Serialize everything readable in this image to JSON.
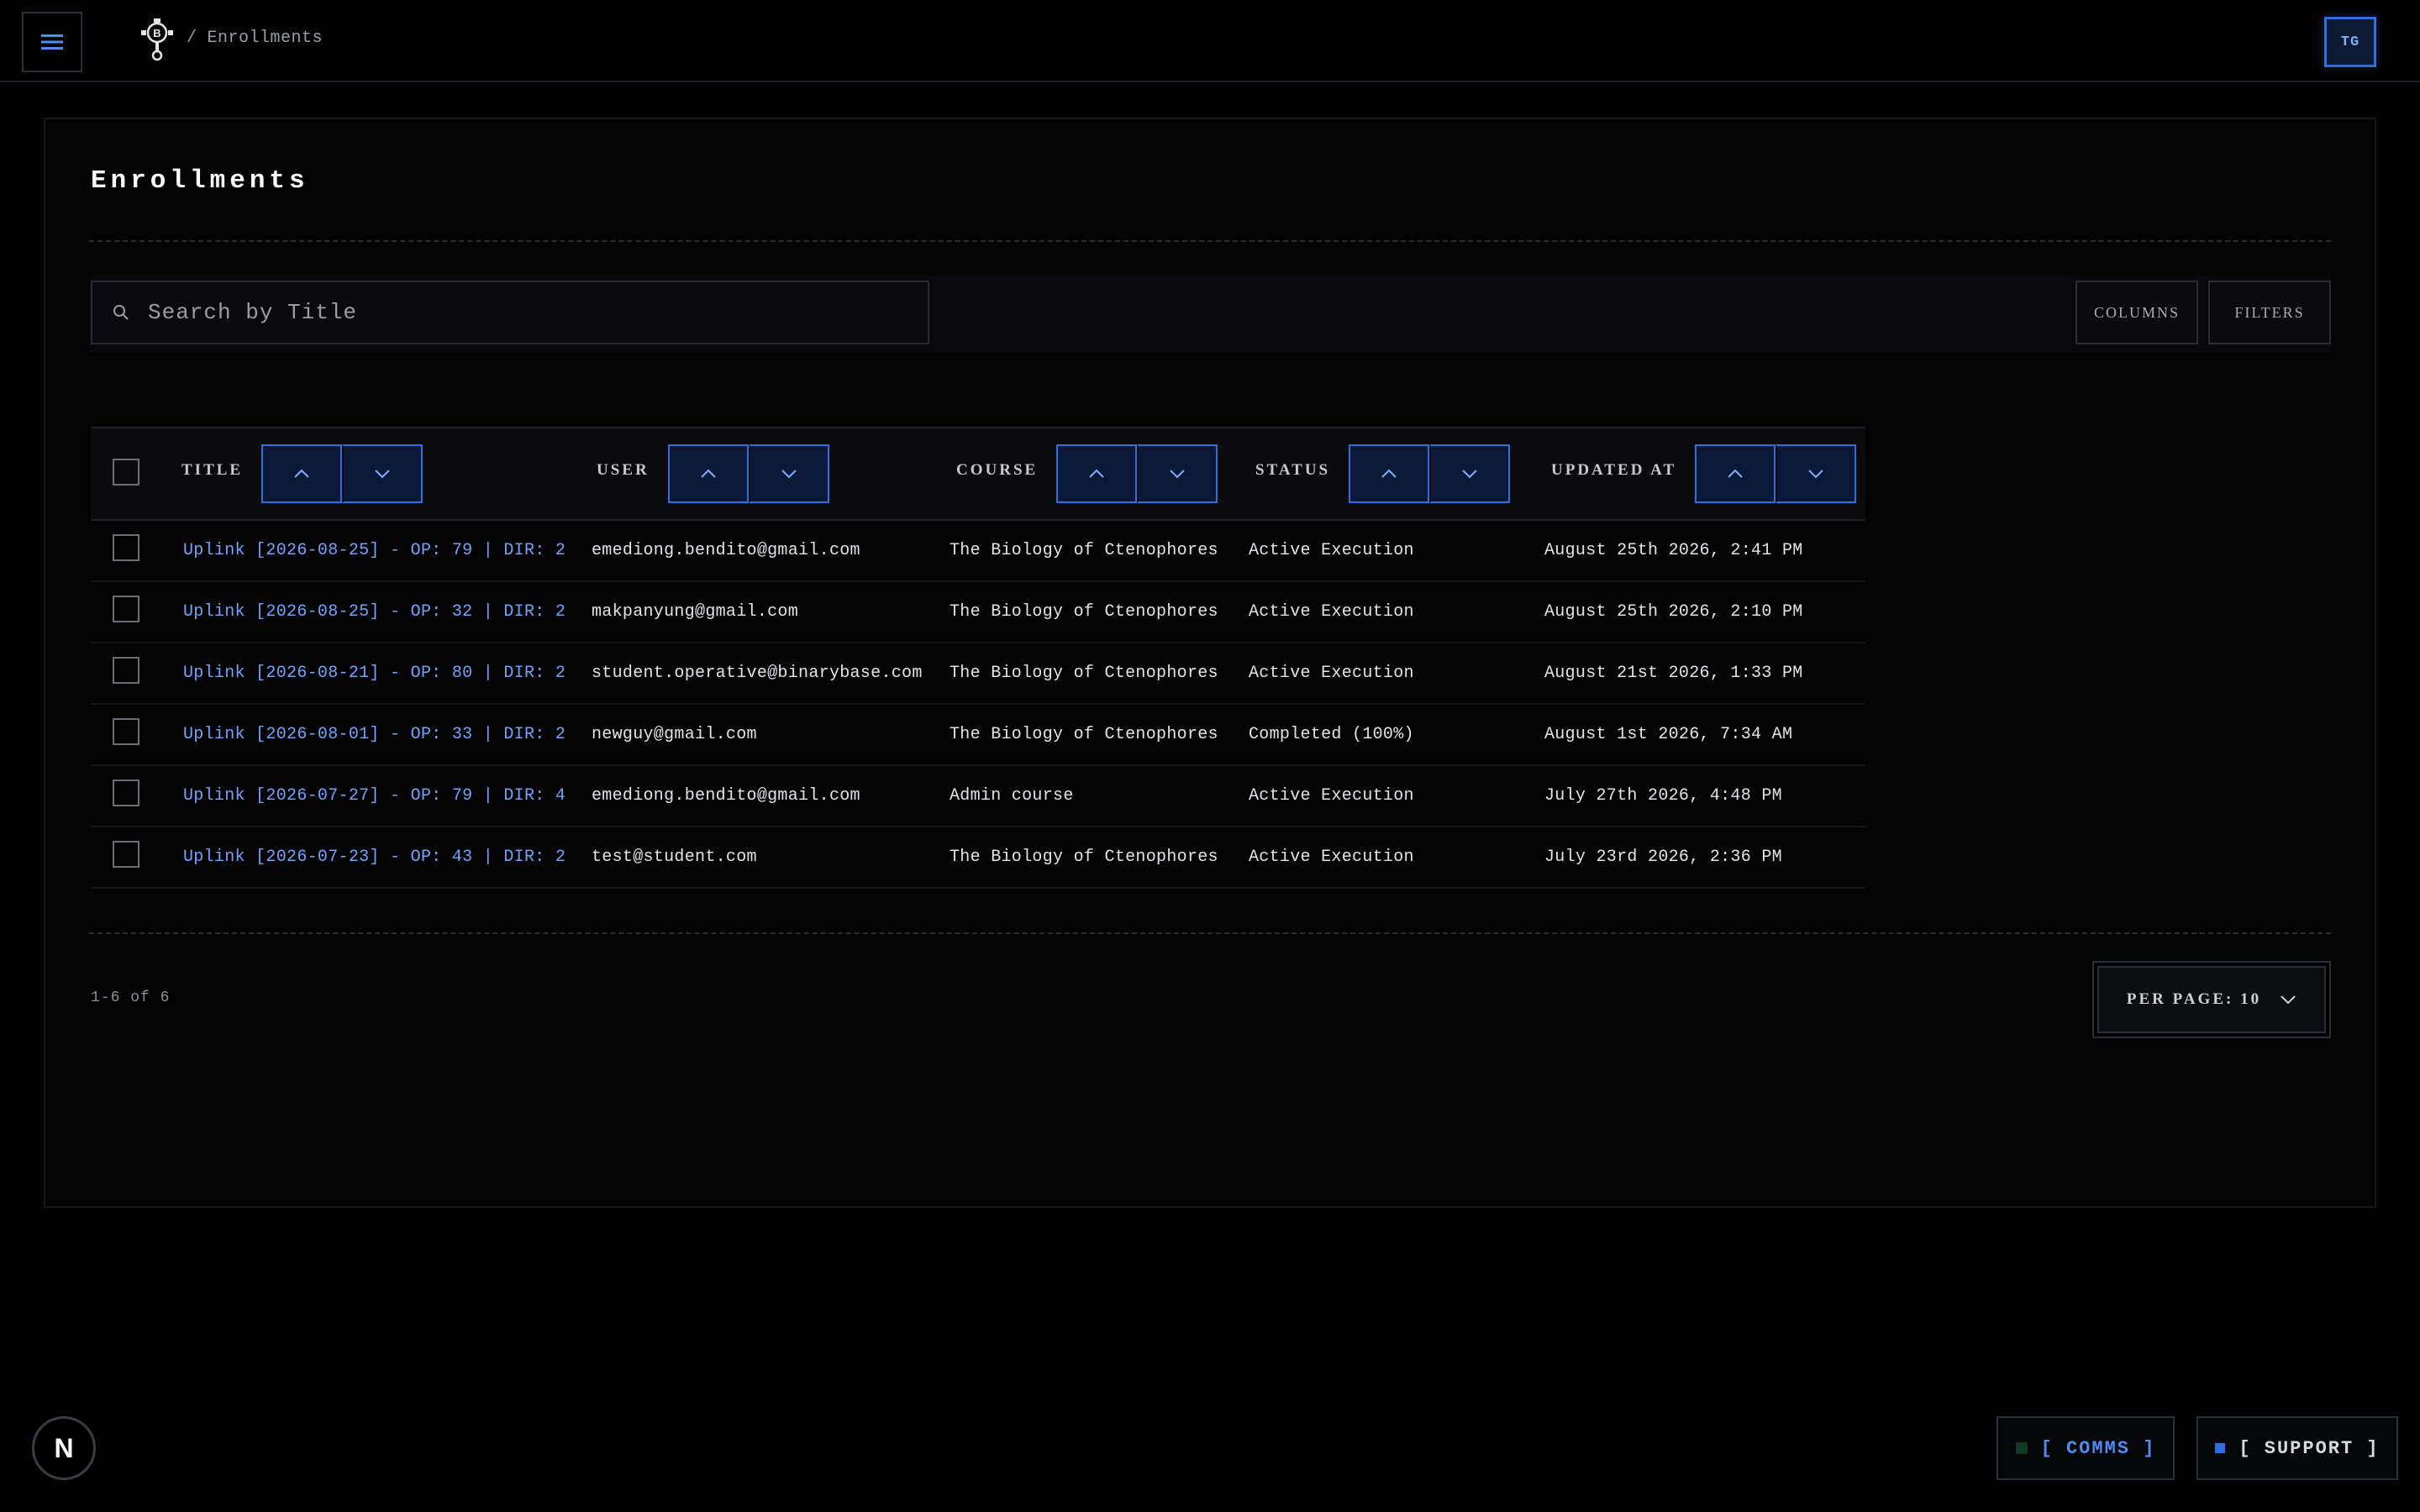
{
  "header": {
    "breadcrumb_sep": "/",
    "breadcrumb_current": "Enrollments",
    "avatar_initials": "TG",
    "menu_icon": "hamburger-icon",
    "logo_icon": "robot-logo-icon"
  },
  "page": {
    "title": "Enrollments",
    "search_placeholder": "Search by Title",
    "columns_label": "COLUMNS",
    "filters_label": "FILTERS"
  },
  "table": {
    "headers": {
      "title": "TITLE",
      "user": "USER",
      "course": "COURSE",
      "status": "STATUS",
      "updated_at": "UPDATED AT"
    },
    "rows": [
      {
        "title": "Uplink [2026-08-25] - OP: 79 | DIR: 2",
        "user": "emediong.bendito@gmail.com",
        "course": "The Biology of Ctenophores",
        "status": "Active Execution",
        "updated_at": "August 25th 2026, 2:41 PM"
      },
      {
        "title": "Uplink [2026-08-25] - OP: 32 | DIR: 2",
        "user": "makpanyung@gmail.com",
        "course": "The Biology of Ctenophores",
        "status": "Active Execution",
        "updated_at": "August 25th 2026, 2:10 PM"
      },
      {
        "title": "Uplink [2026-08-21] - OP: 80 | DIR: 2",
        "user": "student.operative@binarybase.com",
        "course": "The Biology of Ctenophores",
        "status": "Active Execution",
        "updated_at": "August 21st 2026, 1:33 PM"
      },
      {
        "title": "Uplink [2026-08-01] - OP: 33 | DIR: 2",
        "user": "newguy@gmail.com",
        "course": "The Biology of Ctenophores",
        "status": "Completed (100%)",
        "updated_at": "August 1st 2026, 7:34 AM"
      },
      {
        "title": "Uplink [2026-07-27] - OP: 79 | DIR: 4",
        "user": "emediong.bendito@gmail.com",
        "course": "Admin course",
        "status": "Active Execution",
        "updated_at": "July 27th 2026, 4:48 PM"
      },
      {
        "title": "Uplink [2026-07-23] - OP: 43 | DIR: 2",
        "user": "test@student.com",
        "course": "The Biology of Ctenophores",
        "status": "Active Execution",
        "updated_at": "July 23rd 2026, 2:36 PM"
      }
    ]
  },
  "pagination": {
    "range_text": "1-6 of 6",
    "per_page_label": "PER PAGE: 10"
  },
  "footer": {
    "n_badge": "N",
    "comms_label": "[ COMMS ]",
    "support_label": "[ SUPPORT ]"
  },
  "colors": {
    "accent": "#2f6fe0",
    "link": "#6fa4ff",
    "comms_dot": "#0e3a22",
    "support_dot": "#2f6fe0"
  }
}
